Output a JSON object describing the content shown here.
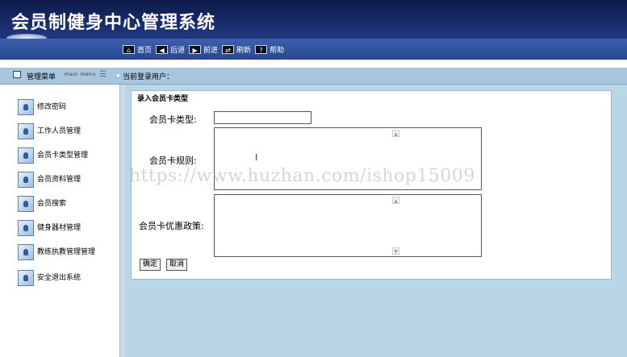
{
  "header": {
    "title": "会员制健身中心管理系统"
  },
  "toolbar": [
    {
      "icon": "home-icon",
      "glyph": "⌂",
      "label": "首页"
    },
    {
      "icon": "back-icon",
      "glyph": "◀",
      "label": "后退"
    },
    {
      "icon": "forward-icon",
      "glyph": "▶",
      "label": "前进"
    },
    {
      "icon": "refresh-icon",
      "glyph": "⇄",
      "label": "刷新"
    },
    {
      "icon": "help-icon",
      "glyph": "?",
      "label": "帮助"
    }
  ],
  "menubar": {
    "menu_label": "管理菜单",
    "menu_sub": "main menu",
    "toggle": "☰",
    "current_user_label": "当前登录用户："
  },
  "sidebar": {
    "items": [
      {
        "label": "修改密码"
      },
      {
        "label": "工作人员管理"
      },
      {
        "label": "会员卡类型管理"
      },
      {
        "label": "会员资料管理"
      },
      {
        "label": "会员搜索"
      },
      {
        "label": "健身器材管理"
      },
      {
        "label": "教练执教管理管理"
      },
      {
        "label": "安全退出系统"
      }
    ]
  },
  "form": {
    "title": "录入会员卡类型",
    "type_label": "会员卡类型:",
    "type_value": "",
    "rules_label": "会员卡规则:",
    "rules_value": "",
    "policy_label": "会员卡优惠政策:",
    "policy_value": "",
    "ok_label": "确定",
    "cancel_label": "取消",
    "cursor": "I"
  },
  "watermark": "https://www.huzhan.com/ishop15009",
  "colors": {
    "header_dark": "#0d1a4a",
    "header_band": "#2a4796",
    "menubar": "#a8c6de",
    "content_bg": "#b9d6e6"
  }
}
